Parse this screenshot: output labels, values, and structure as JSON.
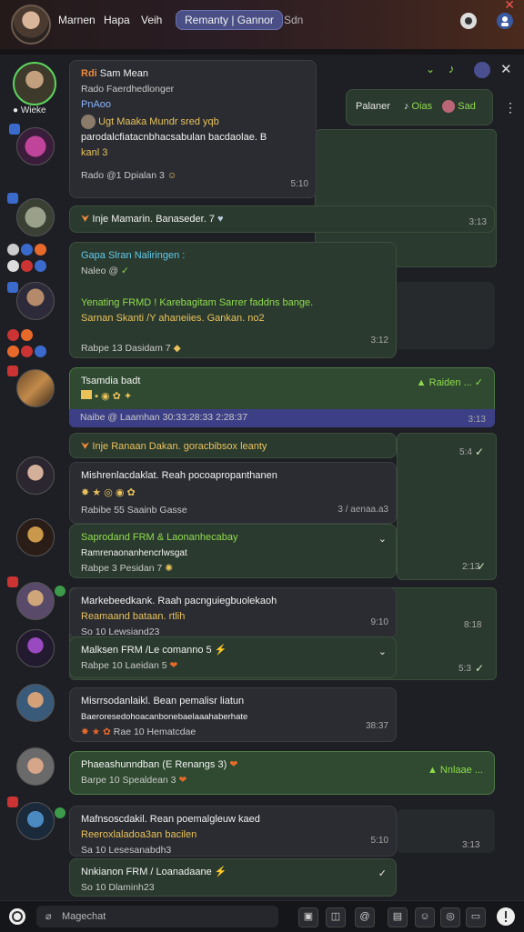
{
  "header": {
    "nav_items": [
      "Marnen",
      "Hapa",
      "Veih"
    ],
    "active_tab": "Remanty | Gannor",
    "extra_tab": "Sdn"
  },
  "pinned": {
    "label": "Palaner",
    "music_label": "Oias",
    "user_label": "Sad"
  },
  "profile": {
    "name": "Wieke"
  },
  "messages": [
    {
      "sender": "Sam Mean",
      "sub": "Rado Faerdhedlonger",
      "sub2": "PnAoo",
      "body_l1": "Ugt Maaka Mundr sred yqb",
      "body_l2": "parodalcfiatacnbhacsabulan bacdaolae. B",
      "body_l3": "kanl 3",
      "meta": "Rado @1 Dpialan 3",
      "time": "5:10"
    },
    {
      "line": "Inje Mamarin. Banaseder. 7",
      "time": "3:13"
    },
    {
      "sender": "Gapa Slran Naliringen :",
      "sub": "Naleo @",
      "body_l1": "Yenating FRMD ! Karebagitam Sarrer faddns bange.",
      "body_l2": "Sarnan Skanti /Y ahaneiies. Gankan. no2",
      "meta": "Rabpe 13 Dasidam 7",
      "time": "3:12"
    },
    {
      "title": "Tsamdia badt",
      "reply_label": "Raiden ...",
      "footer": "Naibe @ Laamhan 30:33:28:33 2:28:37",
      "time": "3:13"
    },
    {
      "line": "Inje Ranaan Dakan. goracbibsox leanty",
      "time": "5:4"
    },
    {
      "header": "Mishrenlacdaklat. Reah pocoapropanthanen",
      "meta": "Rabibe 55 Saainb Gasse",
      "meta_right": "3 / aenaa.a3"
    },
    {
      "line": "Saprodand FRM & Laonanhecabay",
      "sub": "Ramrenaonanhencrlwsgat",
      "meta": "Rabpe 3 Pesidan 7",
      "time": "2:13"
    },
    {
      "header": "Markebeedkank. Raah pacnguiegbuolekaoh",
      "sub": "Reamaand bataan. rtlih",
      "meta": "So 10 Lewsiand23",
      "time": "9:10"
    },
    {
      "line": "Malksen FRM /Le comanno 5",
      "meta": "Rabpe 10 Laeidan 5",
      "time": "5:3"
    },
    {
      "header": "Misrrsodanlaikl. Bean pemalisr liatun",
      "sub": "Baeroresedohoacanbonebaelaaahaberhate",
      "meta": "Rae 10 Hematcdae",
      "time": "38:37"
    },
    {
      "line": "Phaeashunndban (E Renangs 3)",
      "meta": "Barpe 10 Spealdean 3",
      "reply_label": "Nnlaae ..."
    },
    {
      "header": "Mafnsoscdakil. Rean poemalgleuw kaed",
      "sub": "Reeroxlaladoa3an bacilen",
      "meta": "Sa 10 Lesesanabdh3",
      "time": "5:10"
    },
    {
      "line": "Nnkianon FRM / Loanadaane",
      "meta": "So 10 Dlaminh23"
    }
  ],
  "composer": {
    "placeholder": "Magechat"
  },
  "colors": {
    "accent_purple": "#3d3f86",
    "accent_green": "#2f4a30",
    "bubble_dark": "#2a2c31",
    "text_yellow": "#e9c25a",
    "text_green": "#8fdc4e"
  }
}
